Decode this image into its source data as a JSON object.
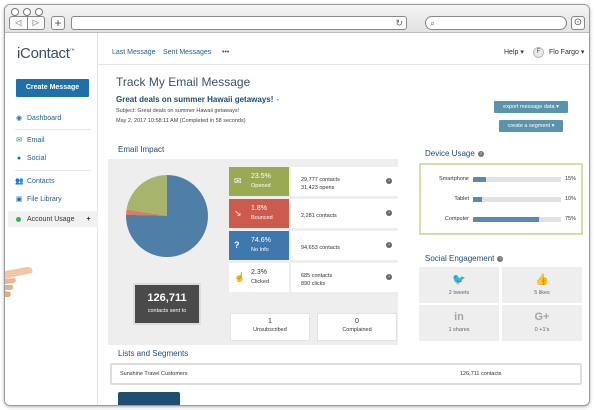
{
  "browser": {
    "back_label": "◁",
    "forward_label": "▷",
    "new_tab_label": "+",
    "reload_icon": "reload-icon",
    "search_icon": "search-icon",
    "settings_icon": "gear-icon"
  },
  "sidebar": {
    "logo": "iContact",
    "create_message": "Create Message",
    "items": [
      {
        "label": "Dashboard",
        "icon": "dashboard-icon"
      },
      {
        "label": "Email",
        "icon": "email-icon"
      },
      {
        "label": "Social",
        "icon": "social-icon"
      },
      {
        "label": "Contacts",
        "icon": "contacts-icon"
      },
      {
        "label": "File Library",
        "icon": "file-library-icon"
      },
      {
        "label": "Account Usage",
        "icon": "account-usage-icon"
      }
    ],
    "account_usage_plus": "+"
  },
  "topbar": {
    "links": [
      "Last Message",
      "Sent Messages",
      "•••"
    ],
    "help": "Help ▾",
    "avatar": "F",
    "user": "Flo Fargo ▾"
  },
  "main": {
    "title": "Track My Email Message",
    "subject_title": "Great deals on summer Hawaii getaways!",
    "subject_line": "Subject: Great deals on summer Hawaii getaways!",
    "date_line": "May 2, 2017 10:58:11 AM (Completed in 58 seconds)",
    "export_button": "export message data ▾",
    "segment_button": "create a segment ▾"
  },
  "email_impact": {
    "heading": "Email Impact",
    "total": "126,711",
    "total_label": "contacts sent to",
    "stats": [
      {
        "pct": "23.5%",
        "label": "Opened",
        "color": "#9aa953",
        "icon": "envelope-open-icon",
        "detail": [
          "29,777 contacts",
          "31,423 opens"
        ]
      },
      {
        "pct": "1.8%",
        "label": "Bounced",
        "color": "#cc5b4d",
        "icon": "bounce-arrow-icon",
        "detail": [
          "2,281 contacts"
        ]
      },
      {
        "pct": "74.6%",
        "label": "No Info",
        "color": "#3f78ad",
        "icon": "question-icon",
        "detail": [
          "94,653 contacts"
        ]
      },
      {
        "pct": "2.3%",
        "label": "Clicked",
        "color": "#ffffff",
        "icon": "hand-pointer-icon",
        "detail": [
          "685 contacts",
          "890 clicks"
        ]
      }
    ],
    "unsubscribed": {
      "value": "1",
      "label": "Unsubscribed"
    },
    "complained": {
      "value": "0",
      "label": "Complained"
    },
    "pie": {
      "no_info": 74.6,
      "bounced": 1.8,
      "opened": 23.5
    }
  },
  "device_usage": {
    "heading": "Device Usage",
    "rows": [
      {
        "name": "Smartphone",
        "pct": "15%",
        "value": 15
      },
      {
        "name": "Tablet",
        "pct": "10%",
        "value": 10
      },
      {
        "name": "Computer",
        "pct": "75%",
        "value": 75
      }
    ]
  },
  "social": {
    "heading": "Social Engagement",
    "tiles": [
      {
        "icon": "twitter-icon",
        "glyph": "🐦",
        "label": "2 tweets"
      },
      {
        "icon": "like-icon",
        "glyph": "👍",
        "label": "5 likes"
      },
      {
        "icon": "linkedin-icon",
        "glyph": "in",
        "label": "1 shares"
      },
      {
        "icon": "google-plus-icon",
        "glyph": "G+",
        "label": "0 +1's"
      }
    ]
  },
  "lists": {
    "heading": "Lists and Segments",
    "rows": [
      {
        "name": "Sunshine Travel Customers",
        "count": "126,711 contacts"
      }
    ]
  },
  "colors": {
    "primary": "#1f6fa8",
    "heading": "#1f4e72",
    "panel": "#eeeeee",
    "device_border": "#cfe0a8"
  }
}
